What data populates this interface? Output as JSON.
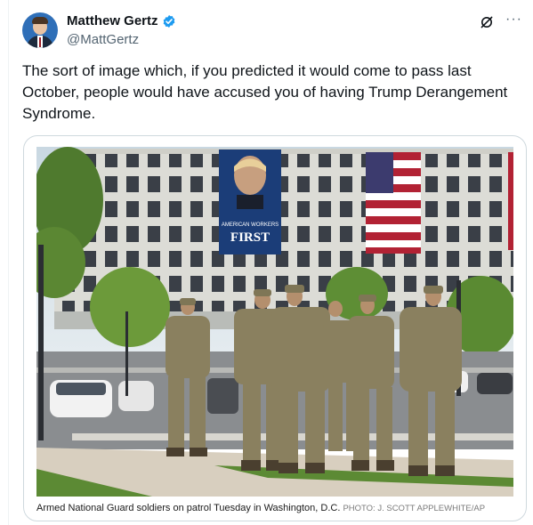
{
  "author": {
    "display_name": "Matthew Gertz",
    "handle": "@MattGertz",
    "verified": true
  },
  "tweet": {
    "text": "The sort of image which, if you predicted it would come to pass last October, people would have accused you of having Trump Derangement Syndrome."
  },
  "media": {
    "caption": "Armed National Guard soldiers on patrol Tuesday in Washington, D.C.",
    "credit": "PHOTO: J. SCOTT APPLEWHITE/AP",
    "banner": {
      "kicker": "AMERICAN WORKERS",
      "headline": "FIRST"
    }
  },
  "icons": {
    "verified": "verified-badge-icon",
    "grok": "grok-icon",
    "more": "more-options-icon"
  },
  "colors": {
    "verified_blue": "#1d9bf0",
    "secondary_text": "#536471",
    "card_border": "#cfd9de"
  }
}
